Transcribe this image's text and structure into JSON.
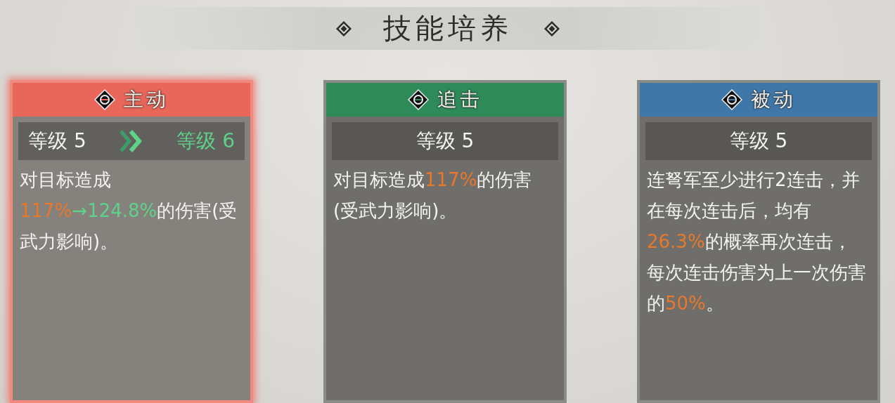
{
  "title": "技能培养",
  "cards": [
    {
      "kind": "upgrade",
      "selected": true,
      "color": "#e8675a",
      "name": "主动",
      "level": "等级 5",
      "next_level": "等级 6",
      "description": [
        {
          "text": "对目标造成",
          "color": "#f2f2ee"
        },
        {
          "text": "117%",
          "color": "#e8782a"
        },
        {
          "text": "→124.8%",
          "color": "#5fd28a"
        },
        {
          "text": "的伤害(受武力影响)。",
          "color": "#f2f2ee"
        }
      ]
    },
    {
      "kind": "plain",
      "selected": false,
      "color": "#2f8a5a",
      "name": "追击",
      "level": "等级 5",
      "description": [
        {
          "text": "对目标造成",
          "color": "#f2f2ee"
        },
        {
          "text": "117%",
          "color": "#e8782a"
        },
        {
          "text": "的伤害(受武力影响)。",
          "color": "#f2f2ee"
        }
      ]
    },
    {
      "kind": "plain",
      "selected": false,
      "color": "#3f78a8",
      "name": "被动",
      "level": "等级 5",
      "description": [
        {
          "text": "连弩军至少进行2连击，并在每次连击后，均有",
          "color": "#f2f2ee"
        },
        {
          "text": "26.3%",
          "color": "#e8782a"
        },
        {
          "text": "的概率再次连击，每次连击伤害为上一次伤害的",
          "color": "#f2f2ee"
        },
        {
          "text": "50%",
          "color": "#e8782a"
        },
        {
          "text": "。",
          "color": "#f2f2ee"
        }
      ]
    }
  ]
}
